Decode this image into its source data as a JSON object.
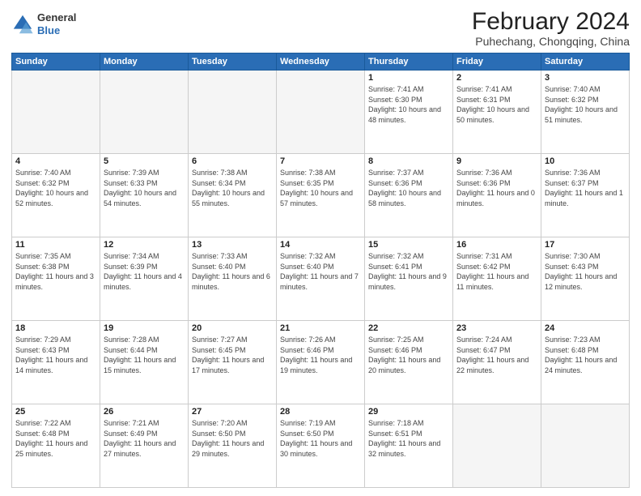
{
  "header": {
    "logo": {
      "line1": "General",
      "line2": "Blue"
    },
    "title": "February 2024",
    "subtitle": "Puhechang, Chongqing, China"
  },
  "weekdays": [
    "Sunday",
    "Monday",
    "Tuesday",
    "Wednesday",
    "Thursday",
    "Friday",
    "Saturday"
  ],
  "weeks": [
    [
      {
        "day": "",
        "empty": true
      },
      {
        "day": "",
        "empty": true
      },
      {
        "day": "",
        "empty": true
      },
      {
        "day": "",
        "empty": true
      },
      {
        "day": "1",
        "sunrise": "7:41 AM",
        "sunset": "6:30 PM",
        "daylight": "10 hours and 48 minutes."
      },
      {
        "day": "2",
        "sunrise": "7:41 AM",
        "sunset": "6:31 PM",
        "daylight": "10 hours and 50 minutes."
      },
      {
        "day": "3",
        "sunrise": "7:40 AM",
        "sunset": "6:32 PM",
        "daylight": "10 hours and 51 minutes."
      }
    ],
    [
      {
        "day": "4",
        "sunrise": "7:40 AM",
        "sunset": "6:32 PM",
        "daylight": "10 hours and 52 minutes."
      },
      {
        "day": "5",
        "sunrise": "7:39 AM",
        "sunset": "6:33 PM",
        "daylight": "10 hours and 54 minutes."
      },
      {
        "day": "6",
        "sunrise": "7:38 AM",
        "sunset": "6:34 PM",
        "daylight": "10 hours and 55 minutes."
      },
      {
        "day": "7",
        "sunrise": "7:38 AM",
        "sunset": "6:35 PM",
        "daylight": "10 hours and 57 minutes."
      },
      {
        "day": "8",
        "sunrise": "7:37 AM",
        "sunset": "6:36 PM",
        "daylight": "10 hours and 58 minutes."
      },
      {
        "day": "9",
        "sunrise": "7:36 AM",
        "sunset": "6:36 PM",
        "daylight": "11 hours and 0 minutes."
      },
      {
        "day": "10",
        "sunrise": "7:36 AM",
        "sunset": "6:37 PM",
        "daylight": "11 hours and 1 minute."
      }
    ],
    [
      {
        "day": "11",
        "sunrise": "7:35 AM",
        "sunset": "6:38 PM",
        "daylight": "11 hours and 3 minutes."
      },
      {
        "day": "12",
        "sunrise": "7:34 AM",
        "sunset": "6:39 PM",
        "daylight": "11 hours and 4 minutes."
      },
      {
        "day": "13",
        "sunrise": "7:33 AM",
        "sunset": "6:40 PM",
        "daylight": "11 hours and 6 minutes."
      },
      {
        "day": "14",
        "sunrise": "7:32 AM",
        "sunset": "6:40 PM",
        "daylight": "11 hours and 7 minutes."
      },
      {
        "day": "15",
        "sunrise": "7:32 AM",
        "sunset": "6:41 PM",
        "daylight": "11 hours and 9 minutes."
      },
      {
        "day": "16",
        "sunrise": "7:31 AM",
        "sunset": "6:42 PM",
        "daylight": "11 hours and 11 minutes."
      },
      {
        "day": "17",
        "sunrise": "7:30 AM",
        "sunset": "6:43 PM",
        "daylight": "11 hours and 12 minutes."
      }
    ],
    [
      {
        "day": "18",
        "sunrise": "7:29 AM",
        "sunset": "6:43 PM",
        "daylight": "11 hours and 14 minutes."
      },
      {
        "day": "19",
        "sunrise": "7:28 AM",
        "sunset": "6:44 PM",
        "daylight": "11 hours and 15 minutes."
      },
      {
        "day": "20",
        "sunrise": "7:27 AM",
        "sunset": "6:45 PM",
        "daylight": "11 hours and 17 minutes."
      },
      {
        "day": "21",
        "sunrise": "7:26 AM",
        "sunset": "6:46 PM",
        "daylight": "11 hours and 19 minutes."
      },
      {
        "day": "22",
        "sunrise": "7:25 AM",
        "sunset": "6:46 PM",
        "daylight": "11 hours and 20 minutes."
      },
      {
        "day": "23",
        "sunrise": "7:24 AM",
        "sunset": "6:47 PM",
        "daylight": "11 hours and 22 minutes."
      },
      {
        "day": "24",
        "sunrise": "7:23 AM",
        "sunset": "6:48 PM",
        "daylight": "11 hours and 24 minutes."
      }
    ],
    [
      {
        "day": "25",
        "sunrise": "7:22 AM",
        "sunset": "6:48 PM",
        "daylight": "11 hours and 25 minutes."
      },
      {
        "day": "26",
        "sunrise": "7:21 AM",
        "sunset": "6:49 PM",
        "daylight": "11 hours and 27 minutes."
      },
      {
        "day": "27",
        "sunrise": "7:20 AM",
        "sunset": "6:50 PM",
        "daylight": "11 hours and 29 minutes."
      },
      {
        "day": "28",
        "sunrise": "7:19 AM",
        "sunset": "6:50 PM",
        "daylight": "11 hours and 30 minutes."
      },
      {
        "day": "29",
        "sunrise": "7:18 AM",
        "sunset": "6:51 PM",
        "daylight": "11 hours and 32 minutes."
      },
      {
        "day": "",
        "empty": true
      },
      {
        "day": "",
        "empty": true
      }
    ]
  ]
}
